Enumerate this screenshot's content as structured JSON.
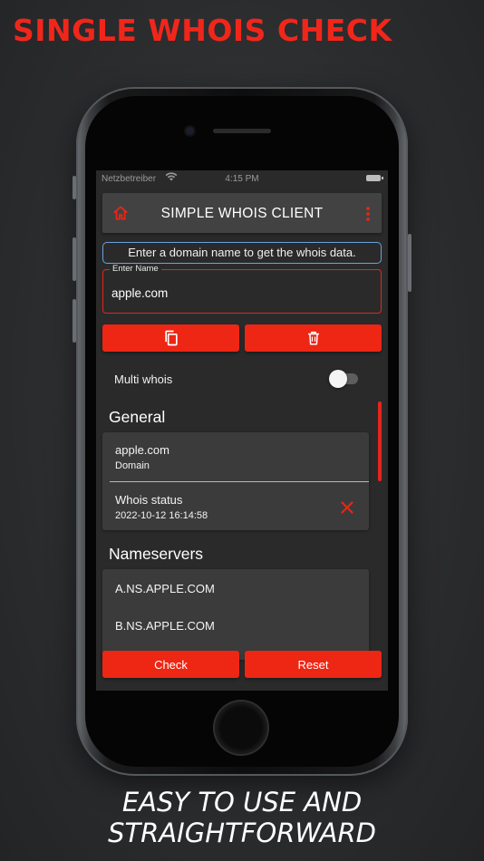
{
  "promo": {
    "headline": "SINGLE WHOIS CHECK",
    "tagline_line1": "EASY TO USE AND",
    "tagline_line2": "STRAIGHTFORWARD"
  },
  "status_bar": {
    "carrier": "Netzbetreiber",
    "time": "4:15 PM"
  },
  "app_bar": {
    "title": "SIMPLE WHOIS CLIENT",
    "left_icon": "home-icon",
    "right_icon": "more-vert-icon"
  },
  "info_text": "Enter a domain name to get the whois data.",
  "domain_input": {
    "label": "Enter Name",
    "value": "apple.com"
  },
  "action_buttons": {
    "copy_icon": "copy-icon",
    "delete_icon": "trash-icon"
  },
  "multi_whois": {
    "label": "Multi whois",
    "enabled": false
  },
  "general": {
    "heading": "General",
    "domain_value": "apple.com",
    "domain_label": "Domain",
    "whois_status_label": "Whois status",
    "whois_status_time": "2022-10-12 16:14:58"
  },
  "nameservers": {
    "heading": "Nameservers",
    "items": [
      "A.NS.APPLE.COM",
      "B.NS.APPLE.COM"
    ]
  },
  "bottom_buttons": {
    "check_label": "Check",
    "reset_label": "Reset"
  },
  "colors": {
    "accent_red": "#ee2614",
    "info_border_blue": "#6aa2dd",
    "card_bg": "#3b3b3c",
    "screen_bg": "#2a2a2b"
  }
}
